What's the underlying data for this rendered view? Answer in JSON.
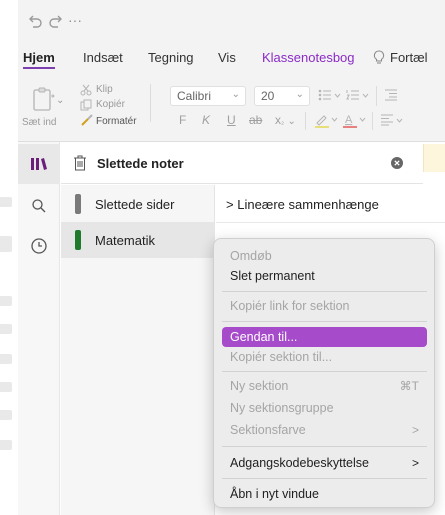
{
  "quick_access": {
    "undo_icon": "undo-icon",
    "redo_icon": "redo-icon",
    "more": "···"
  },
  "tabs": [
    "Hjem",
    "Indsæt",
    "Tegning",
    "Vis",
    "Klassenotesbog",
    "Fortæl"
  ],
  "ribbon": {
    "paste_label": "Sæt ind",
    "cut_label": "Klip",
    "copy_label": "Kopiér",
    "format_label": "Formatér",
    "font_name": "Calibri",
    "font_size": "20",
    "bold": "F",
    "italic": "K",
    "underline": "U",
    "strike": "ab",
    "subscript": "x"
  },
  "header": {
    "title": "Slettede noter"
  },
  "sections": [
    {
      "label": "Slettede sider",
      "color": "#7a7a7a"
    },
    {
      "label": "Matematik",
      "color": "#1f7a2e"
    }
  ],
  "pages": [
    {
      "label": "Lineære sammenhænge"
    }
  ],
  "context_menu": {
    "items": [
      {
        "label": "Omdøb",
        "disabled": true
      },
      {
        "label": "Slet permanent",
        "disabled": false
      },
      {
        "label": "Kopiér link for sektion",
        "disabled": true
      },
      {
        "label": "Gendan til...",
        "disabled": false,
        "highlighted": true
      },
      {
        "label": "Kopiér sektion til...",
        "disabled": true
      },
      {
        "label": "Ny sektion",
        "disabled": true,
        "shortcut": "⌘T"
      },
      {
        "label": "Ny sektionsgruppe",
        "disabled": true
      },
      {
        "label": "Sektionsfarve",
        "disabled": true,
        "submenu": ">"
      },
      {
        "label": "Adgangskodebeskyttelse",
        "disabled": false,
        "submenu": ">"
      },
      {
        "label": "Åbn i nyt vindue",
        "disabled": false
      }
    ]
  },
  "colors": {
    "accent": "#a64bc9",
    "tab_underline": "#7b3fb0",
    "klassenotesbog": "#8a2bc7"
  }
}
